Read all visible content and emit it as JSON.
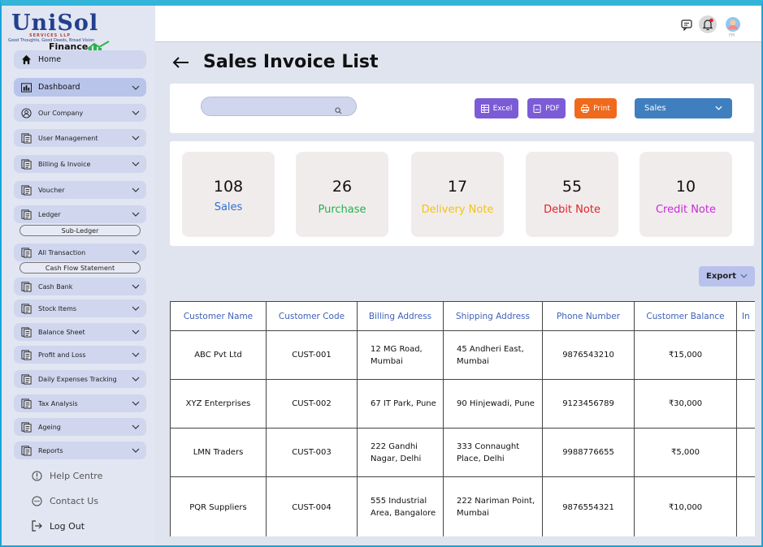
{
  "logo": {
    "brand": "UniSol",
    "services": "SERVICES LLP",
    "tagline": "Good Thoughts, Good Deeds, Broad Vision",
    "product": "Finance"
  },
  "sidebar": {
    "home": "Home",
    "dashboard": "Dashboard",
    "items": [
      {
        "label": "Our Company",
        "icon": "people-icon"
      },
      {
        "label": "User Management",
        "icon": "document-icon"
      },
      {
        "label": "Billing & Invoice",
        "icon": "document-icon"
      },
      {
        "label": "Voucher",
        "icon": "document-icon"
      },
      {
        "label": "Ledger",
        "icon": "document-icon"
      },
      {
        "label": "All Transaction",
        "icon": "document-icon"
      },
      {
        "label": "Cash Bank",
        "icon": "document-icon"
      },
      {
        "label": "Stock Items",
        "icon": "document-icon"
      },
      {
        "label": "Balance Sheet",
        "icon": "document-icon"
      },
      {
        "label": "Profit and Loss",
        "icon": "document-icon"
      },
      {
        "label": "Daily Expenses Tracking",
        "icon": "document-icon"
      },
      {
        "label": "Tax Analysis",
        "icon": "document-icon"
      },
      {
        "label": "Ageing",
        "icon": "document-icon"
      },
      {
        "label": "Reports",
        "icon": "document-icon"
      }
    ],
    "sub_ledger": "Sub-Ledger",
    "sub_cashflow": "Cash Flow Statement",
    "help": "Help Centre",
    "contact": "Contact Us",
    "logout": "Log Out"
  },
  "topbar": {
    "avatar_initials": "FM"
  },
  "page": {
    "title": "Sales Invoice List"
  },
  "toolbar": {
    "search_placeholder": "",
    "excel": "Excel",
    "pdf": "PDF",
    "print": "Print",
    "select_value": "Sales",
    "colors": {
      "excel": "#7b5cd6",
      "pdf": "#7b5cd6",
      "print": "#f06a1d",
      "select": "#3f7fbf"
    }
  },
  "stats": [
    {
      "value": "108",
      "label": "Sales",
      "color": "#2f6fd1"
    },
    {
      "value": "26",
      "label": "Purchase",
      "color": "#23b14d"
    },
    {
      "value": "17",
      "label": "Delivery Note",
      "color": "#f1c40f"
    },
    {
      "value": "55",
      "label": "Debit Note",
      "color": "#e0222a"
    },
    {
      "value": "10",
      "label": "Credit Note",
      "color": "#c62ad6"
    }
  ],
  "export_label": "Export",
  "table": {
    "columns": [
      "Customer Name",
      "Customer Code",
      "Billing Address",
      "Shipping Address",
      "Phone Number",
      "Customer Balance",
      "In"
    ],
    "rows": [
      [
        "ABC Pvt Ltd",
        "CUST-001",
        "12 MG Road, Mumbai",
        "45 Andheri East, Mumbai",
        "9876543210",
        "₹15,000",
        ""
      ],
      [
        "XYZ Enterprises",
        "CUST-002",
        "67 IT Park, Pune",
        "90 Hinjewadi, Pune",
        "9123456789",
        "₹30,000",
        ""
      ],
      [
        "LMN Traders",
        "CUST-003",
        "222 Gandhi Nagar, Delhi",
        "333 Connaught Place, Delhi",
        "9988776655",
        "₹5,000",
        ""
      ],
      [
        "PQR Suppliers",
        "CUST-004",
        "555 Industrial Area, Bangalore",
        "222 Nariman Point, Mumbai",
        "9876554321",
        "₹10,000",
        ""
      ]
    ]
  }
}
